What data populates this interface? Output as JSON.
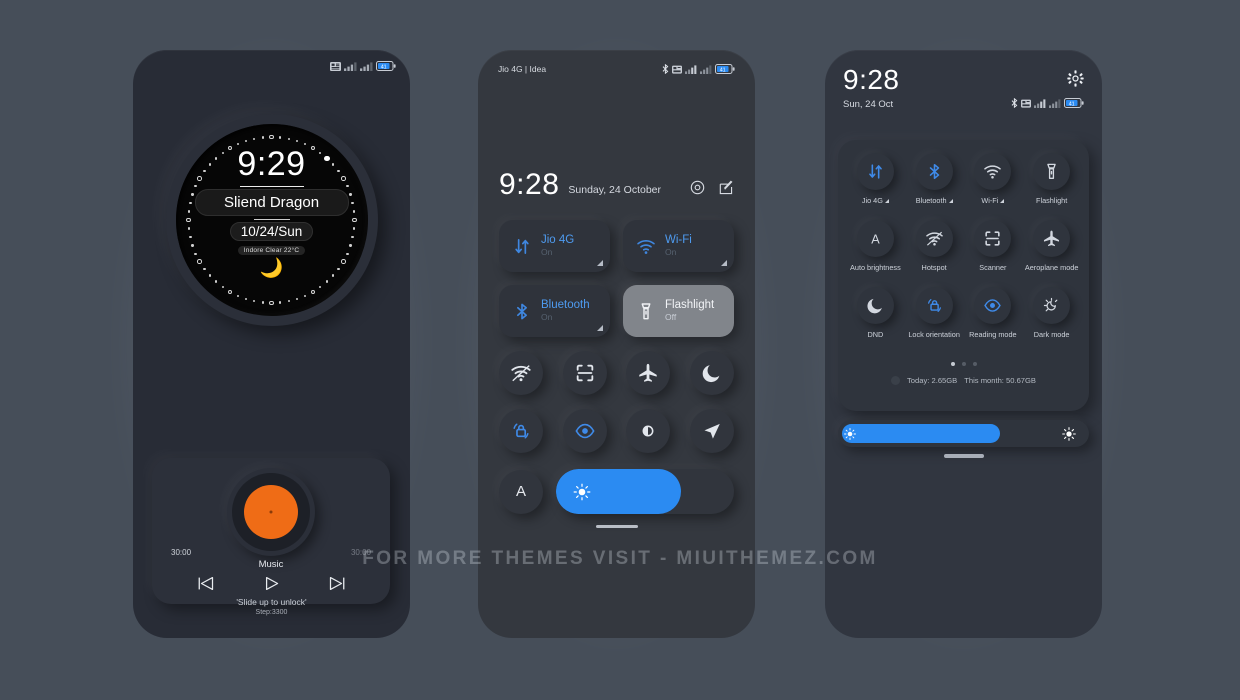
{
  "watermark": "FOR MORE THEMES VISIT - MIUITHEMEZ.COM",
  "colors": {
    "background": "#464e59",
    "accent_blue": "#2b8bf2",
    "tile_label_blue": "#4e9bf0",
    "disc_orange": "#ef6c16",
    "phone1_body": "#282c36",
    "phone2_body": "#34383f",
    "phone3_body": "#313640"
  },
  "phone1": {
    "name": "lockscreen",
    "status_icons": [
      "sim-data-icon",
      "signal-bars-icon",
      "signal-bars-icon",
      "battery-icon"
    ],
    "battery_level": "41",
    "clock": {
      "time": "9:29",
      "owner_name": "Sliend Dragon",
      "date": "10/24/Sun",
      "weather": "Indore Clear 22°C",
      "moon_icon": "🌙"
    },
    "music": {
      "elapsed": "30:00",
      "total": "30:00",
      "title": "Music",
      "controls": [
        "previous-icon",
        "play-icon",
        "next-icon"
      ]
    },
    "unlock_hint": "'Slide up to unlock'",
    "step_counter": "Step:3300"
  },
  "phone2": {
    "name": "notification-shade",
    "carrier": "Jio 4G | Idea",
    "status_icons": [
      "bluetooth-icon",
      "alarm-icon",
      "signal-bars-icon",
      "signal-bars-icon",
      "battery-icon"
    ],
    "battery_level": "41",
    "time": "9:28",
    "date": "Sunday, 24 October",
    "header_icons": [
      "settings-icon",
      "edit-icon"
    ],
    "big_tiles": [
      {
        "label": "Jio 4G",
        "state": "On",
        "icon": "mobile-data-icon",
        "active": false,
        "expandable": true
      },
      {
        "label": "Wi-Fi",
        "state": "On",
        "icon": "wifi-icon",
        "active": false,
        "expandable": true
      },
      {
        "label": "Bluetooth",
        "state": "On",
        "icon": "bluetooth-icon",
        "active": false,
        "expandable": true
      },
      {
        "label": "Flashlight",
        "state": "Off",
        "icon": "flashlight-icon",
        "active": true,
        "expandable": false
      }
    ],
    "circle_row_1": [
      "hotspot-icon",
      "scanner-icon",
      "aeroplane-icon",
      "dnd-moon-icon"
    ],
    "circle_row_2": [
      "lock-orientation-icon",
      "reading-mode-icon",
      "dark-mode-icon",
      "location-icon"
    ],
    "auto_brightness_label": "A",
    "brightness_percent": 70
  },
  "phone3": {
    "name": "control-center",
    "time": "9:28",
    "date": "Sun, 24 Oct",
    "gear_icon": "settings-icon",
    "status_icons": [
      "bluetooth-icon",
      "alarm-icon",
      "signal-bars-icon",
      "signal-bars-icon",
      "battery-icon"
    ],
    "battery_level": "41",
    "toggles": [
      {
        "label": "Jio 4G",
        "icon": "mobile-data-icon",
        "active": true,
        "caret": true
      },
      {
        "label": "Bluetooth",
        "icon": "bluetooth-icon",
        "active": true,
        "caret": true
      },
      {
        "label": "Wi-Fi",
        "icon": "wifi-icon",
        "active": false,
        "caret": true
      },
      {
        "label": "Flashlight",
        "icon": "flashlight-icon",
        "active": false,
        "caret": false
      },
      {
        "label": "Auto brightness",
        "icon": "auto-brightness-icon",
        "active": false,
        "caret": false
      },
      {
        "label": "Hotspot",
        "icon": "hotspot-icon",
        "active": false,
        "caret": false
      },
      {
        "label": "Scanner",
        "icon": "scanner-icon",
        "active": false,
        "caret": false
      },
      {
        "label": "Aeroplane mode",
        "icon": "aeroplane-icon",
        "active": false,
        "caret": false
      },
      {
        "label": "DND",
        "icon": "dnd-moon-icon",
        "active": false,
        "caret": false
      },
      {
        "label": "Lock orientation",
        "icon": "lock-orientation-icon",
        "active": true,
        "caret": false
      },
      {
        "label": "Reading mode",
        "icon": "reading-mode-icon",
        "active": true,
        "caret": false
      },
      {
        "label": "Dark mode",
        "icon": "dark-mode-icon",
        "active": false,
        "caret": false
      }
    ],
    "page_dots": 3,
    "active_dot": 0,
    "data_today_label": "Today: 2.65GB",
    "data_month_label": "This month: 50.67GB",
    "brightness_percent": 66
  }
}
